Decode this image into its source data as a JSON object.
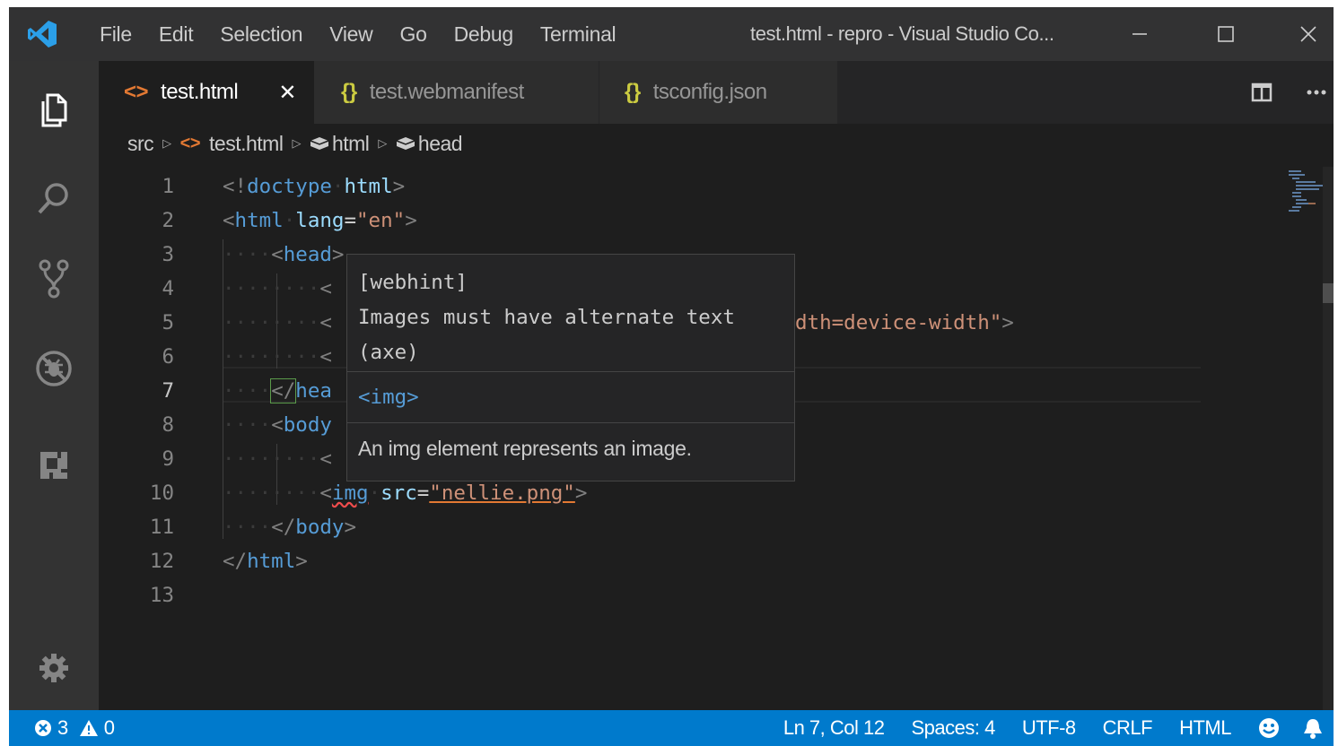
{
  "titlebar": {
    "menu": [
      "File",
      "Edit",
      "Selection",
      "View",
      "Go",
      "Debug",
      "Terminal"
    ],
    "title": "test.html - repro - Visual Studio Co..."
  },
  "tabs": [
    {
      "label": "test.html",
      "icon": "<>",
      "active": true
    },
    {
      "label": "test.webmanifest",
      "icon": "{}",
      "active": false
    },
    {
      "label": "tsconfig.json",
      "icon": "{}",
      "active": false
    }
  ],
  "breadcrumb": {
    "folder": "src",
    "file": "test.html",
    "icon": "<>",
    "element1": "html",
    "element2": "head"
  },
  "editor": {
    "line_numbers": [
      "1",
      "2",
      "3",
      "4",
      "5",
      "6",
      "7",
      "8",
      "9",
      "10",
      "11",
      "12",
      "13"
    ],
    "current_line": "7",
    "code": {
      "l1_open": "<!",
      "l1_kw": "doctype",
      "l1_name": "html",
      "l1_close": ">",
      "l2_open": "<",
      "l2_tag": "html",
      "l2_attr": "lang",
      "l2_eq": "=",
      "l2_val": "\"en\"",
      "l2_close": ">",
      "l3_open": "<",
      "l3_tag": "head",
      "l3_close": ">",
      "l4_frag": "<",
      "l5_frag": "<",
      "l5_tail": "dth=device-width\"",
      "l5_close": ">",
      "l6_frag": "<",
      "l7_open": "</",
      "l7_tag": "hea",
      "l8_open": "<",
      "l8_tag": "body",
      "l9_frag": "<",
      "l10_open": "<",
      "l10_tag": "img",
      "l10_attr": "src",
      "l10_eq": "=",
      "l10_val": "\"nellie.png\"",
      "l10_close": ">",
      "l11_open": "</",
      "l11_tag": "body",
      "l11_close": ">",
      "l12_open": "</",
      "l12_tag": "html",
      "l12_close": ">"
    }
  },
  "hover": {
    "source": "[webhint]",
    "message_line1": "Images must have alternate text",
    "message_line2": "(axe)",
    "element": "<img>",
    "description": "An img element represents an image."
  },
  "statusbar": {
    "errors": "3",
    "warnings": "0",
    "position": "Ln 7, Col 12",
    "spaces": "Spaces: 4",
    "encoding": "UTF-8",
    "eol": "CRLF",
    "language": "HTML"
  },
  "colors": {
    "accent": "#007acc",
    "tag": "#569cd6",
    "attribute": "#9cdcfe",
    "string": "#ce9178",
    "html_icon": "#e37933",
    "json_icon": "#cbcb41"
  }
}
